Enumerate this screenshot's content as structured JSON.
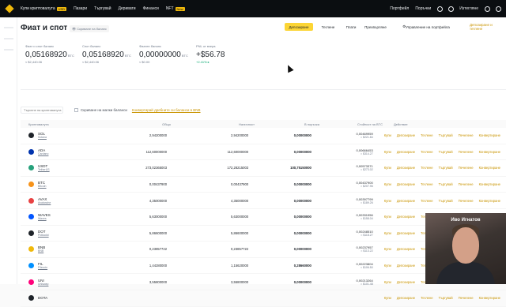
{
  "topbar": {
    "nav": [
      {
        "label": "Купи криптовалута",
        "badge": "USD"
      },
      {
        "label": "Пазари"
      },
      {
        "label": "Търгувай"
      },
      {
        "label": "Деривати"
      },
      {
        "label": "Финанси"
      },
      {
        "label": "NFT",
        "badge": "New"
      }
    ],
    "right": [
      "Портфейл",
      "Поръчки"
    ],
    "lang": "Изтегляне"
  },
  "header": {
    "title": "Фиат и спот",
    "hidden_note": "Скриване на баланс",
    "buttons": [
      "Депозиране",
      "Теглене",
      "Плати",
      "Прехвърляне",
      "Управление на портфейла"
    ],
    "extra_link": "Депозиране и теглене"
  },
  "summary": [
    {
      "label": "Фиат и спот баланс",
      "value": "0,05168920",
      "unit": "BTC",
      "sub": "≈ $2,440.06"
    },
    {
      "label": "Спот баланс",
      "value": "0,05168920",
      "unit": "BTC",
      "sub": "≈ $2,440.06"
    },
    {
      "label": "Фиатен баланс",
      "value": "0,00000000",
      "unit": "BTC",
      "sub": "≈ $0.00"
    },
    {
      "label": "PNL от вчера",
      "value": "+$56.78",
      "unit": "",
      "sub": "+2.41%"
    }
  ],
  "filters": {
    "search_placeholder": "Търсене на криптовалута",
    "hide_small": "Скриване на малки баланси",
    "convert_link": "Конвертирай дребните си баланси в BNB"
  },
  "table": {
    "headers": [
      "Криптовалута",
      "Общо",
      "Наличност",
      "В поръчка",
      "Стойност на BTC",
      "Действие"
    ],
    "actions": [
      "Купи",
      "Депозиране",
      "Теглене",
      "Търгувай",
      "Печелене",
      "Конвертиране"
    ],
    "rows": [
      {
        "sym": "SOL",
        "name": "Solana",
        "color": "#1e2329",
        "total": "2,94200000",
        "avail": "2,94200000",
        "order": "0,00000000",
        "btc": "0,00469959",
        "usd": "≈ $221.84"
      },
      {
        "sym": "ADA",
        "name": "Cardano",
        "color": "#0033ad",
        "total": "112,60000000",
        "avail": "112,60000000",
        "order": "0,00000000",
        "btc": "0,00666453",
        "usd": "≈ $314.27"
      },
      {
        "sym": "USDT",
        "name": "TetherUS",
        "color": "#26a17b",
        "total": "273,02365003",
        "avail": "172,28215003",
        "order": "100,75150000",
        "btc": "0,00573371",
        "usd": "≈ $273.02"
      },
      {
        "sym": "BTC",
        "name": "Bitcoin",
        "color": "#f7931a",
        "total": "0,00437900",
        "avail": "0,00437900",
        "order": "0,00000000",
        "btc": "0,00437900",
        "usd": "≈ $207.96"
      },
      {
        "sym": "AVAX",
        "name": "Avalanche",
        "color": "#e84142",
        "total": "4,35000000",
        "avail": "4,35000000",
        "order": "0,00000000",
        "btc": "0,00397799",
        "usd": "≈ $189.26"
      },
      {
        "sym": "WAVES",
        "name": "Waves",
        "color": "#0155ff",
        "total": "5,63000000",
        "avail": "5,63000000",
        "order": "0,00000000",
        "btc": "0,00331956",
        "usd": "≈ $158.04"
      },
      {
        "sym": "DOT",
        "name": "Polkadot",
        "color": "#1e2329",
        "total": "5,86600000",
        "avail": "5,86600000",
        "order": "0,00000000",
        "btc": "0,00248510",
        "usd": "≈ $118.27"
      },
      {
        "sym": "BNB",
        "name": "BNB",
        "color": "#f0b90b",
        "total": "0,23857722",
        "avail": "0,23857722",
        "order": "0,00000000",
        "btc": "0,00237957",
        "usd": "≈ $113.22"
      },
      {
        "sym": "FIL",
        "name": "Filecoin",
        "color": "#0090ff",
        "total": "1,44280000",
        "avail": "1,15620000",
        "order": "0,28660000",
        "btc": "0,00223804",
        "usd": "≈ $106.50"
      },
      {
        "sym": "UNI",
        "name": "Uniswap",
        "color": "#ff007a",
        "total": "3,55800000",
        "avail": "3,55800000",
        "order": "0,00000000",
        "btc": "0,00213264",
        "usd": "≈ $101.48"
      },
      {
        "sym": "DOTA",
        "name": "",
        "color": "#1e2329",
        "total": "",
        "avail": "",
        "order": "",
        "btc": "",
        "usd": ""
      }
    ]
  },
  "webcam": {
    "name": "Иво Игнатов"
  }
}
